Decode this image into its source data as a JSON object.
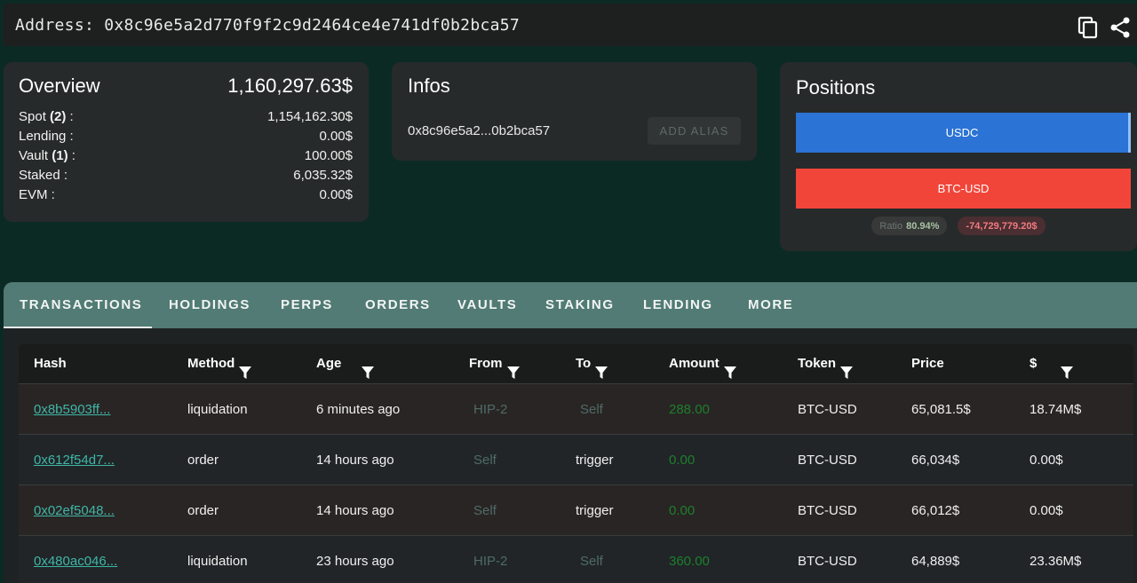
{
  "address": {
    "label": "Address:",
    "value": "0x8c96e5a2d770f9f2c9d2464ce4e741df0b2bca57"
  },
  "overview": {
    "title": "Overview",
    "total": "1,160,297.63$",
    "rows": [
      {
        "label": "Spot",
        "count": "(2)",
        "value": "1,154,162.30$"
      },
      {
        "label": "Lending",
        "count": "",
        "value": "0.00$"
      },
      {
        "label": "Vault",
        "count": "(1)",
        "value": "100.00$"
      },
      {
        "label": "Staked",
        "count": "",
        "value": "6,035.32$"
      },
      {
        "label": "EVM",
        "count": "",
        "value": "0.00$"
      }
    ]
  },
  "infos": {
    "title": "Infos",
    "short_address": "0x8c96e5a2...0b2bca57",
    "alias_button": "ADD ALIAS"
  },
  "positions": {
    "title": "Positions",
    "bars": [
      {
        "label": "USDC",
        "color": "#2b73d4"
      },
      {
        "label": "BTC-USD",
        "color": "#f2453a"
      }
    ],
    "ratio_label": "Ratio",
    "ratio_value": "80.94%",
    "pnl": "-74,729,779.20$"
  },
  "tabs": [
    "TRANSACTIONS",
    "HOLDINGS",
    "PERPS",
    "ORDERS",
    "VAULTS",
    "STAKING",
    "LENDING",
    "MORE"
  ],
  "table": {
    "headers": [
      "Hash",
      "Method",
      "Age",
      "From",
      "To",
      "Amount",
      "Token",
      "Price",
      "$"
    ],
    "rows": [
      {
        "hash": "0x8b5903ff...",
        "method": "liquidation",
        "age": "6 minutes ago",
        "from": "HIP-2",
        "to": "Self",
        "amount": "288.00",
        "token": "BTC-USD",
        "price": "65,081.5$",
        "usd": "18.74M$"
      },
      {
        "hash": "0x612f54d7...",
        "method": "order",
        "age": "14 hours ago",
        "from": "Self",
        "to": "trigger",
        "amount": "0.00",
        "token": "BTC-USD",
        "price": "66,034$",
        "usd": "0.00$"
      },
      {
        "hash": "0x02ef5048...",
        "method": "order",
        "age": "14 hours ago",
        "from": "Self",
        "to": "trigger",
        "amount": "0.00",
        "token": "BTC-USD",
        "price": "66,012$",
        "usd": "0.00$"
      },
      {
        "hash": "0x480ac046...",
        "method": "liquidation",
        "age": "23 hours ago",
        "from": "HIP-2",
        "to": "Self",
        "amount": "360.00",
        "token": "BTC-USD",
        "price": "64,889$",
        "usd": "23.36M$"
      }
    ]
  },
  "colors": {
    "background": "#0c2a24",
    "tabbar": "#517b74",
    "link": "#3fb6a8",
    "positive": "#1d7f2d"
  }
}
